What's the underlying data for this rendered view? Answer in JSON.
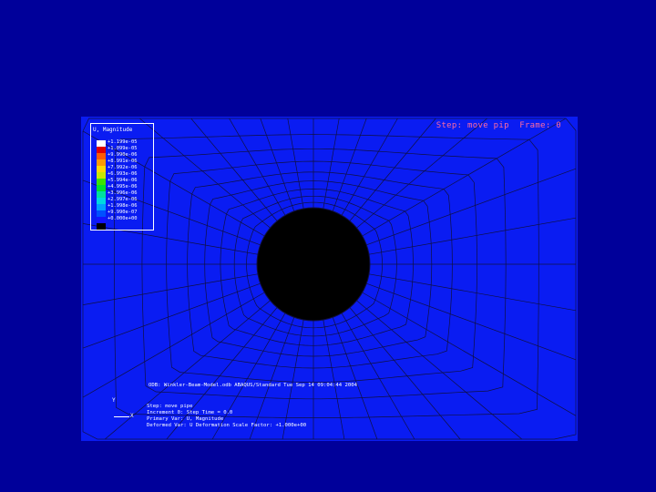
{
  "viewport": {
    "step_label": "Step: move pip  Frame: 0",
    "background_color": "#0a1cf2",
    "hole_color": "#000000"
  },
  "legend": {
    "title": "U, Magnitude",
    "colors": [
      "#ffffff",
      "#e00000",
      "#ff5a00",
      "#ff9a00",
      "#ffd800",
      "#c8e800",
      "#3ce400",
      "#00e030",
      "#00e0a0",
      "#00d8e0",
      "#00a0ff",
      "#0050ff",
      "#1414ff",
      "#000000"
    ],
    "values": [
      "+1.199e-05",
      "+1.099e-05",
      "+9.990e-06",
      "+8.991e-06",
      "+7.992e-06",
      "+6.993e-06",
      "+5.994e-06",
      "+4.995e-06",
      "+3.996e-06",
      "+2.997e-06",
      "+1.998e-06",
      "+9.990e-07",
      "+0.000e+00"
    ]
  },
  "triad": {
    "y_label": "Y",
    "x_label": "X"
  },
  "footer": {
    "odb_line": "ODB: Winkler-Beam-Model.odb    ABAQUS/Standard    Tue Sep 14 09:04:44 2004",
    "info_lines": [
      "Step: move pipe",
      "Increment    0: Step Time =   0.0",
      "Primary Var: U, Magnitude",
      "Deformed Var: U  Deformation Scale Factor: +1.000e+00"
    ]
  }
}
